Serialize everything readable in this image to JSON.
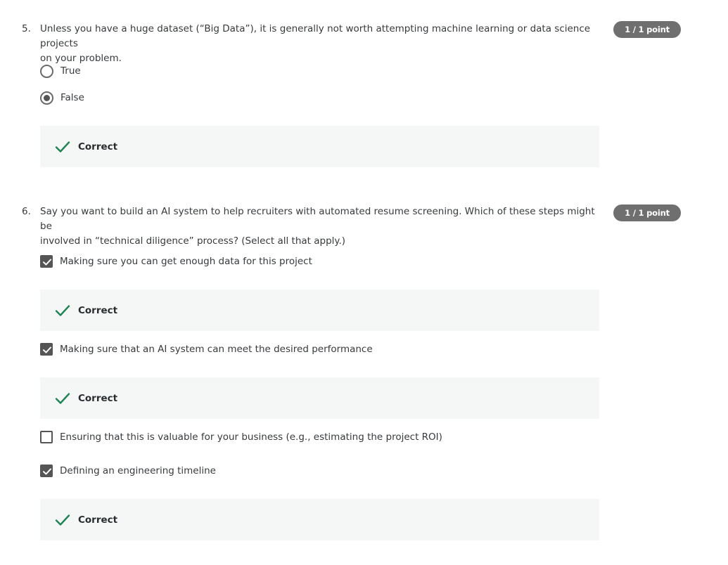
{
  "questions": [
    {
      "number": "5.",
      "text_line1": "Unless you have a huge dataset (“Big Data”), it is generally not worth attempting machine learning or data science projects",
      "text_line2": "on your problem.",
      "points": "1 / 1 point",
      "options": [
        {
          "label": "True",
          "type": "radio",
          "selected": false
        },
        {
          "label": "False",
          "type": "radio",
          "selected": true
        }
      ],
      "feedback": "Correct"
    },
    {
      "number": "6.",
      "text_line1": "Say you want to build an AI system to help recruiters with automated resume screening. Which of these steps might be",
      "text_line2": "involved in “technical diligence” process?  (Select all that apply.)",
      "points": "1 / 1 point",
      "options": [
        {
          "label": "Making sure you can get enough data for this project",
          "type": "checkbox",
          "selected": true,
          "feedback": "Correct"
        },
        {
          "label": "Making sure that an AI system can meet the desired performance",
          "type": "checkbox",
          "selected": true,
          "feedback": "Correct"
        },
        {
          "label": "Ensuring that this is valuable for your business (e.g., estimating the project ROI)",
          "type": "checkbox",
          "selected": false
        },
        {
          "label": "Defining an engineering timeline",
          "type": "checkbox",
          "selected": true,
          "feedback": "Correct"
        }
      ]
    }
  ],
  "colors": {
    "badge_bg": "#6f6f6f",
    "feedback_bg": "#f5f7f7",
    "correct_green": "#1f8354",
    "control_gray": "#555555"
  },
  "icons": {
    "correct": "check-icon",
    "selected_checkbox": "checkmark-icon"
  }
}
